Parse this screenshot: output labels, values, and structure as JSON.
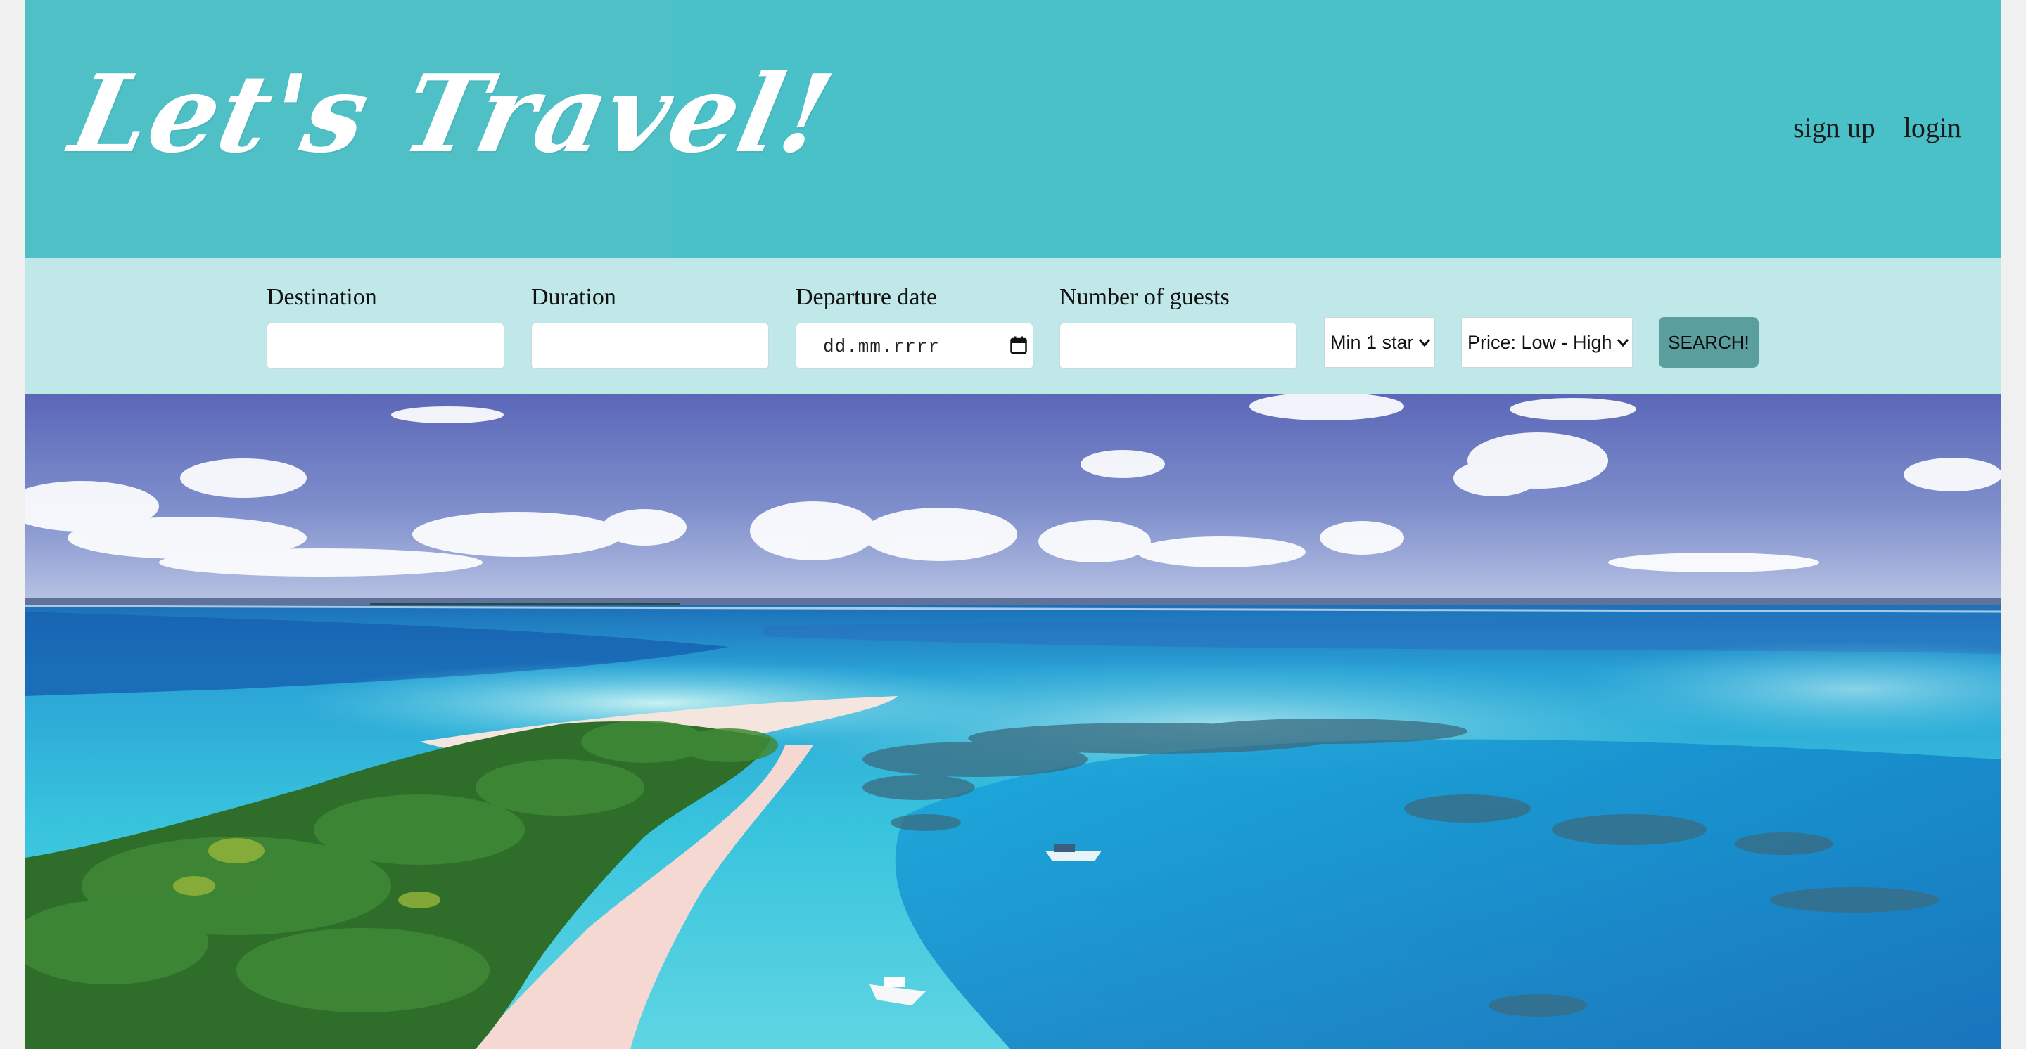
{
  "header": {
    "logo_text": "Let's Travel!",
    "nav": {
      "signup_label": "sign up",
      "login_label": "login"
    }
  },
  "search": {
    "destination": {
      "label": "Destination",
      "value": ""
    },
    "duration": {
      "label": "Duration",
      "value": ""
    },
    "departure": {
      "label": "Departure date",
      "value": "dd.mm.rrrr"
    },
    "guests": {
      "label": "Number of guests",
      "value": ""
    },
    "stars_select": {
      "selected": "Min 1 star"
    },
    "sort_select": {
      "selected": "Price: Low - High"
    },
    "search_button_label": "SEARCH!"
  },
  "hero": {
    "image_subject": "tropical-island-lagoon-aerial"
  },
  "colors": {
    "header_bg": "#4ac1c8",
    "searchbar_bg": "#c0e8e9",
    "button_bg": "#5a9f9e"
  }
}
